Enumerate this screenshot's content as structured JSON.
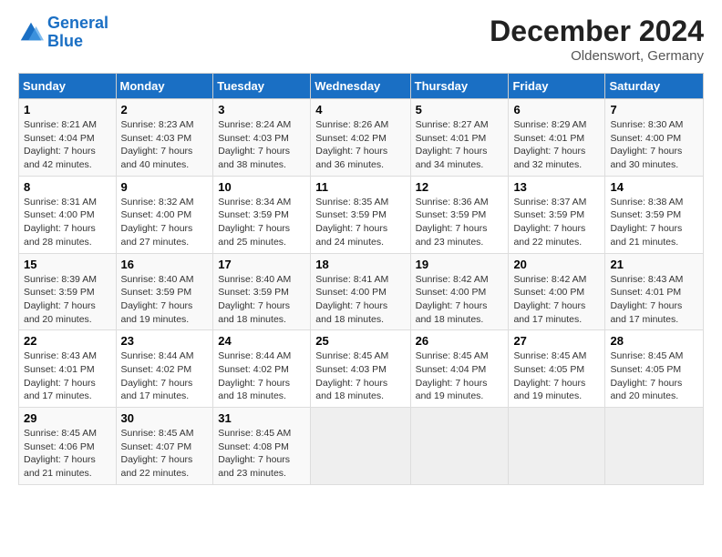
{
  "logo": {
    "line1": "General",
    "line2": "Blue"
  },
  "title": "December 2024",
  "subtitle": "Oldenswort, Germany",
  "weekdays": [
    "Sunday",
    "Monday",
    "Tuesday",
    "Wednesday",
    "Thursday",
    "Friday",
    "Saturday"
  ],
  "weeks": [
    [
      {
        "day": "1",
        "sunrise": "8:21 AM",
        "sunset": "4:04 PM",
        "daylight": "7 hours and 42 minutes."
      },
      {
        "day": "2",
        "sunrise": "8:23 AM",
        "sunset": "4:03 PM",
        "daylight": "7 hours and 40 minutes."
      },
      {
        "day": "3",
        "sunrise": "8:24 AM",
        "sunset": "4:03 PM",
        "daylight": "7 hours and 38 minutes."
      },
      {
        "day": "4",
        "sunrise": "8:26 AM",
        "sunset": "4:02 PM",
        "daylight": "7 hours and 36 minutes."
      },
      {
        "day": "5",
        "sunrise": "8:27 AM",
        "sunset": "4:01 PM",
        "daylight": "7 hours and 34 minutes."
      },
      {
        "day": "6",
        "sunrise": "8:29 AM",
        "sunset": "4:01 PM",
        "daylight": "7 hours and 32 minutes."
      },
      {
        "day": "7",
        "sunrise": "8:30 AM",
        "sunset": "4:00 PM",
        "daylight": "7 hours and 30 minutes."
      }
    ],
    [
      {
        "day": "8",
        "sunrise": "8:31 AM",
        "sunset": "4:00 PM",
        "daylight": "7 hours and 28 minutes."
      },
      {
        "day": "9",
        "sunrise": "8:32 AM",
        "sunset": "4:00 PM",
        "daylight": "7 hours and 27 minutes."
      },
      {
        "day": "10",
        "sunrise": "8:34 AM",
        "sunset": "3:59 PM",
        "daylight": "7 hours and 25 minutes."
      },
      {
        "day": "11",
        "sunrise": "8:35 AM",
        "sunset": "3:59 PM",
        "daylight": "7 hours and 24 minutes."
      },
      {
        "day": "12",
        "sunrise": "8:36 AM",
        "sunset": "3:59 PM",
        "daylight": "7 hours and 23 minutes."
      },
      {
        "day": "13",
        "sunrise": "8:37 AM",
        "sunset": "3:59 PM",
        "daylight": "7 hours and 22 minutes."
      },
      {
        "day": "14",
        "sunrise": "8:38 AM",
        "sunset": "3:59 PM",
        "daylight": "7 hours and 21 minutes."
      }
    ],
    [
      {
        "day": "15",
        "sunrise": "8:39 AM",
        "sunset": "3:59 PM",
        "daylight": "7 hours and 20 minutes."
      },
      {
        "day": "16",
        "sunrise": "8:40 AM",
        "sunset": "3:59 PM",
        "daylight": "7 hours and 19 minutes."
      },
      {
        "day": "17",
        "sunrise": "8:40 AM",
        "sunset": "3:59 PM",
        "daylight": "7 hours and 18 minutes."
      },
      {
        "day": "18",
        "sunrise": "8:41 AM",
        "sunset": "4:00 PM",
        "daylight": "7 hours and 18 minutes."
      },
      {
        "day": "19",
        "sunrise": "8:42 AM",
        "sunset": "4:00 PM",
        "daylight": "7 hours and 18 minutes."
      },
      {
        "day": "20",
        "sunrise": "8:42 AM",
        "sunset": "4:00 PM",
        "daylight": "7 hours and 17 minutes."
      },
      {
        "day": "21",
        "sunrise": "8:43 AM",
        "sunset": "4:01 PM",
        "daylight": "7 hours and 17 minutes."
      }
    ],
    [
      {
        "day": "22",
        "sunrise": "8:43 AM",
        "sunset": "4:01 PM",
        "daylight": "7 hours and 17 minutes."
      },
      {
        "day": "23",
        "sunrise": "8:44 AM",
        "sunset": "4:02 PM",
        "daylight": "7 hours and 17 minutes."
      },
      {
        "day": "24",
        "sunrise": "8:44 AM",
        "sunset": "4:02 PM",
        "daylight": "7 hours and 18 minutes."
      },
      {
        "day": "25",
        "sunrise": "8:45 AM",
        "sunset": "4:03 PM",
        "daylight": "7 hours and 18 minutes."
      },
      {
        "day": "26",
        "sunrise": "8:45 AM",
        "sunset": "4:04 PM",
        "daylight": "7 hours and 19 minutes."
      },
      {
        "day": "27",
        "sunrise": "8:45 AM",
        "sunset": "4:05 PM",
        "daylight": "7 hours and 19 minutes."
      },
      {
        "day": "28",
        "sunrise": "8:45 AM",
        "sunset": "4:05 PM",
        "daylight": "7 hours and 20 minutes."
      }
    ],
    [
      {
        "day": "29",
        "sunrise": "8:45 AM",
        "sunset": "4:06 PM",
        "daylight": "7 hours and 21 minutes."
      },
      {
        "day": "30",
        "sunrise": "8:45 AM",
        "sunset": "4:07 PM",
        "daylight": "7 hours and 22 minutes."
      },
      {
        "day": "31",
        "sunrise": "8:45 AM",
        "sunset": "4:08 PM",
        "daylight": "7 hours and 23 minutes."
      },
      null,
      null,
      null,
      null
    ]
  ],
  "labels": {
    "sunrise": "Sunrise:",
    "sunset": "Sunset:",
    "daylight": "Daylight:"
  }
}
